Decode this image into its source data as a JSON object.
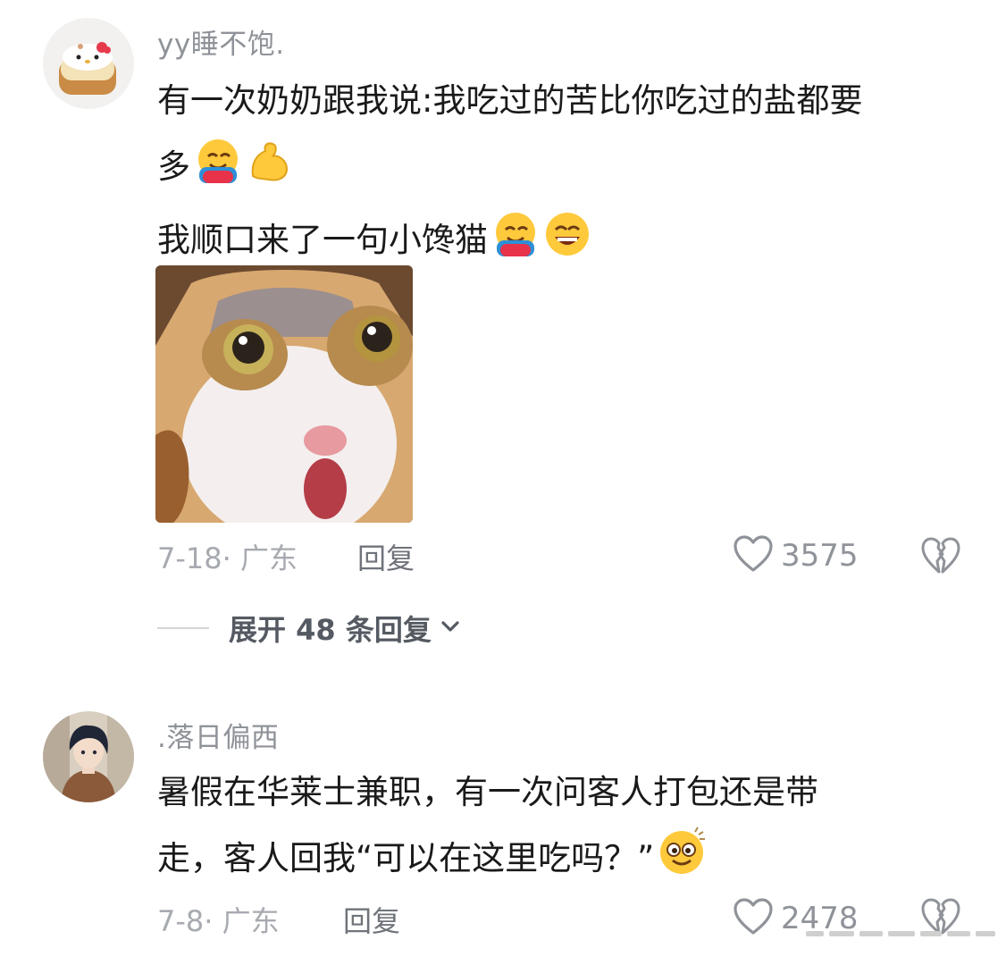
{
  "comments": [
    {
      "username": "yy睡不饱.",
      "text_lines": [
        "有一次奶奶跟我说:我吃过的苦比你吃过的盐都要",
        "多",
        "我顺口来了一句小馋猫"
      ],
      "date_location": "7-18· 广东",
      "reply_label": "回复",
      "likes": "3575",
      "expand_label": "展开 48 条回复"
    },
    {
      "username": ".落日偏西",
      "text_lines": [
        "暑假在华莱士兼职，有一次问客人打包还是带",
        "走，客人回我“可以在这里吃吗？”"
      ],
      "date_location": "7-8· 广东",
      "reply_label": "回复",
      "likes": "2478"
    }
  ],
  "icons": {
    "like": "heart-outline-icon",
    "dislike": "broken-heart-icon",
    "expand": "chevron-down-icon",
    "emoji_hug": "hugging-face-emoji",
    "emoji_muscle": "flexed-biceps-emoji",
    "emoji_grin": "grinning-squinting-face-emoji",
    "emoji_dazed": "dizzy-face-emoji"
  },
  "colors": {
    "username": "#8f9399",
    "text": "#1a1a1a",
    "meta": "#a7aab0",
    "reply": "#6f737a",
    "expand": "#555a62"
  }
}
